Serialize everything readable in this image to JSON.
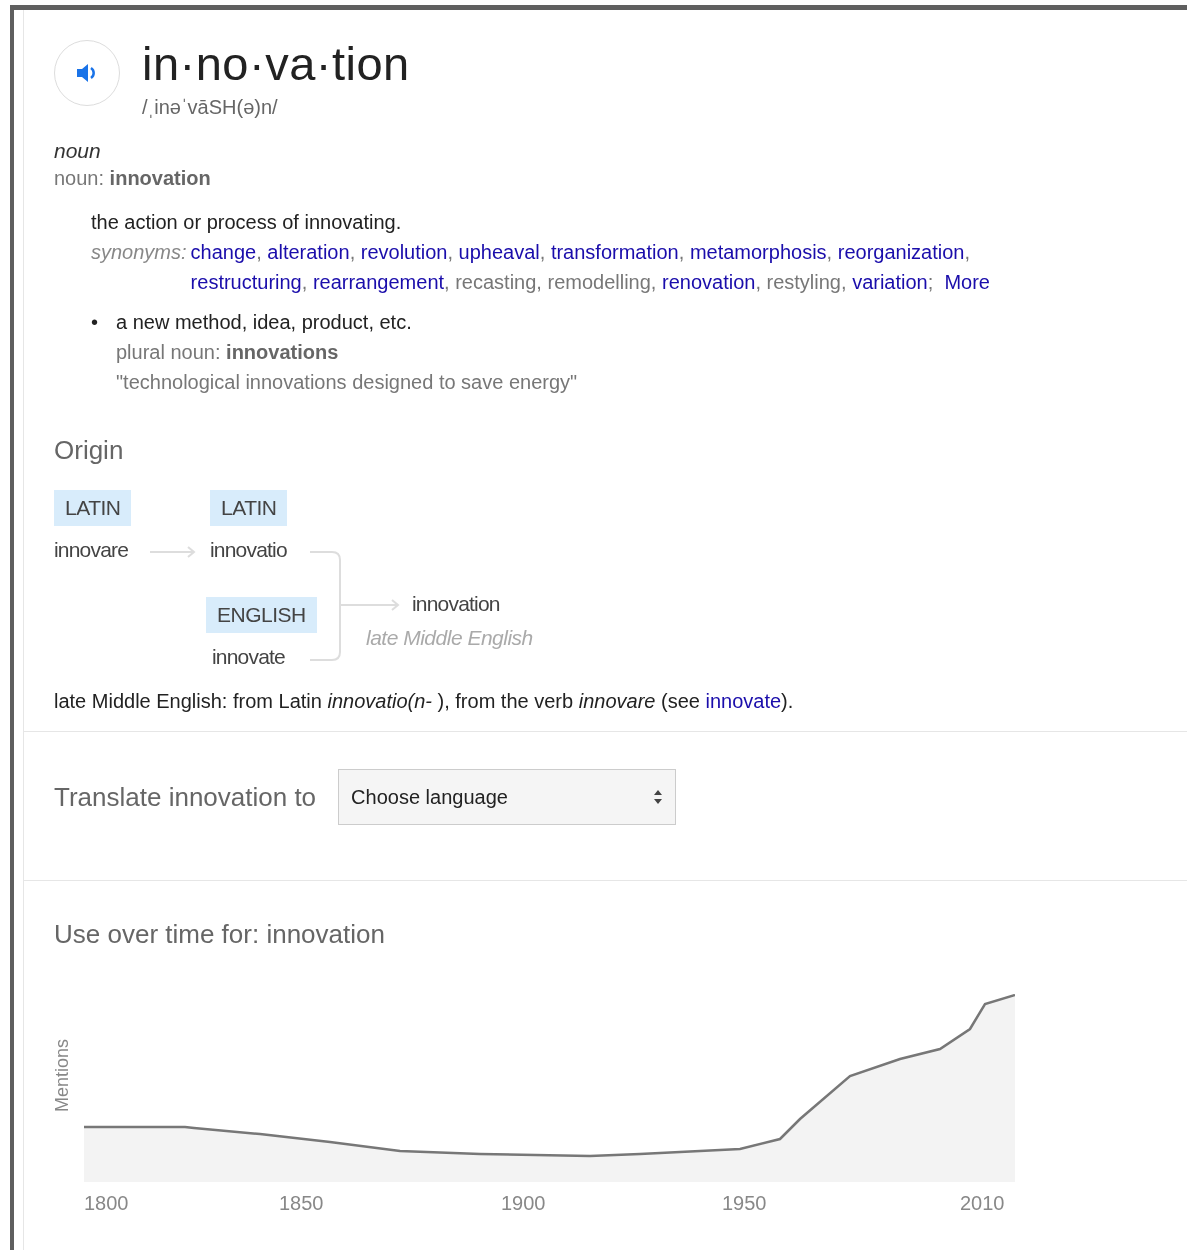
{
  "entry": {
    "headword": "in·no·va·tion",
    "phonetic": "/ˌinəˈvāSH(ə)n/"
  },
  "sense_group": {
    "part_of_speech": "noun",
    "form_label": "noun: **innovation**",
    "definitions": [
      {
        "kind": "main",
        "text": "the action or process of innovating.",
        "synonyms_label": "synonyms:",
        "synonym_separator": ", ",
        "synonym_end": ";",
        "more": "More",
        "synonyms": [
          {
            "word": "change",
            "link": true
          },
          {
            "word": "alteration",
            "link": true
          },
          {
            "word": "revolution",
            "link": true
          },
          {
            "word": "upheaval",
            "link": true
          },
          {
            "word": "transformation",
            "link": true
          },
          {
            "word": "metamorphosis",
            "link": true
          },
          {
            "word": "reorganization",
            "link": true
          },
          {
            "word": "restructuring",
            "link": true
          },
          {
            "word": "rearrangement",
            "link": true
          },
          {
            "word": "recasting",
            "link": false
          },
          {
            "word": "remodelling",
            "link": false
          },
          {
            "word": "renovation",
            "link": true
          },
          {
            "word": "restyling",
            "link": false
          },
          {
            "word": "variation",
            "link": true
          }
        ]
      },
      {
        "kind": "bullet",
        "bullet": "•",
        "text": "a new method, idea, product, etc.",
        "form_label": "plural noun: **innovations**",
        "example": "\"technological innovations designed to save energy\""
      }
    ]
  },
  "origin": {
    "heading": "Origin",
    "chain": [
      {
        "language": "LATIN",
        "word": "innovare"
      },
      {
        "language": "LATIN",
        "word": "innovatio"
      }
    ],
    "merge": {
      "language": "ENGLISH",
      "word": "innovate"
    },
    "result": {
      "word": "innovation",
      "period": "late Middle English"
    },
    "note": [
      {
        "text": "late Middle English: from Latin *innovatio(n-* ), from the verb *innovare* (see ",
        "link": false
      },
      {
        "text": "innovate",
        "link": true
      },
      {
        "text": ").",
        "link": false
      }
    ]
  },
  "translate": {
    "label": "Translate innovation to",
    "select": "Choose language"
  },
  "usage": {
    "title": "Use over time for: innovation",
    "y_label": "Mentions",
    "x_labels": [
      "1800",
      "1850",
      "1900",
      "1950",
      "2010"
    ]
  }
}
